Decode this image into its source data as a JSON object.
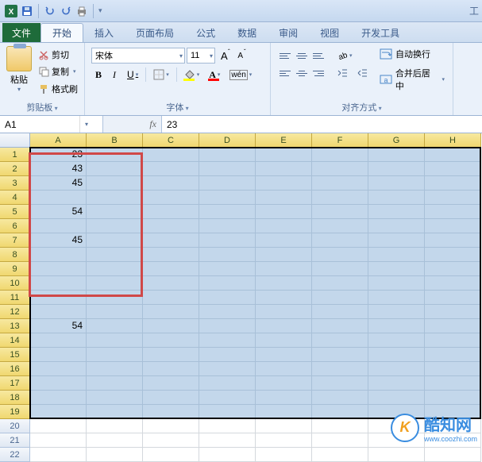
{
  "titlebar": {
    "qat_icons": [
      "excel",
      "save",
      "undo",
      "redo",
      "print",
      "more"
    ]
  },
  "tabs": {
    "file": "文件",
    "items": [
      "开始",
      "插入",
      "页面布局",
      "公式",
      "数据",
      "审阅",
      "视图",
      "开发工具"
    ],
    "active_index": 0
  },
  "ribbon": {
    "clipboard": {
      "paste": "粘贴",
      "cut": "剪切",
      "copy": "复制",
      "format_painter": "格式刷",
      "group": "剪贴板"
    },
    "font": {
      "name": "宋体",
      "size": "11",
      "increase": "A",
      "decrease": "A",
      "bold": "B",
      "italic": "I",
      "underline": "U",
      "group": "字体"
    },
    "alignment": {
      "wrap": "自动换行",
      "merge": "合并后居中",
      "group": "对齐方式"
    }
  },
  "namebox": "A1",
  "formula": "23",
  "columns": [
    "A",
    "B",
    "C",
    "D",
    "E",
    "F",
    "G",
    "H"
  ],
  "rows": [
    "1",
    "2",
    "3",
    "4",
    "5",
    "6",
    "7",
    "8",
    "9",
    "10",
    "11",
    "12",
    "13",
    "14",
    "15",
    "16",
    "17",
    "18",
    "19",
    "20",
    "21",
    "22"
  ],
  "selected_rows_end": 19,
  "cells": {
    "r1": {
      "A": "23"
    },
    "r2": {
      "A": "43"
    },
    "r3": {
      "A": "45"
    },
    "r5": {
      "A": "54"
    },
    "r7": {
      "A": "45"
    },
    "r13": {
      "A": "54"
    }
  },
  "watermark": {
    "logo": "K",
    "text": "酷知网",
    "url": "www.coozhi.com"
  },
  "chart_data": {
    "type": "table",
    "columns": [
      "A"
    ],
    "rows": [
      {
        "row": 1,
        "A": 23
      },
      {
        "row": 2,
        "A": 43
      },
      {
        "row": 3,
        "A": 45
      },
      {
        "row": 4,
        "A": null
      },
      {
        "row": 5,
        "A": 54
      },
      {
        "row": 6,
        "A": null
      },
      {
        "row": 7,
        "A": 45
      },
      {
        "row": 8,
        "A": null
      },
      {
        "row": 9,
        "A": null
      },
      {
        "row": 10,
        "A": null
      },
      {
        "row": 11,
        "A": null
      },
      {
        "row": 12,
        "A": null
      },
      {
        "row": 13,
        "A": 54
      }
    ]
  }
}
